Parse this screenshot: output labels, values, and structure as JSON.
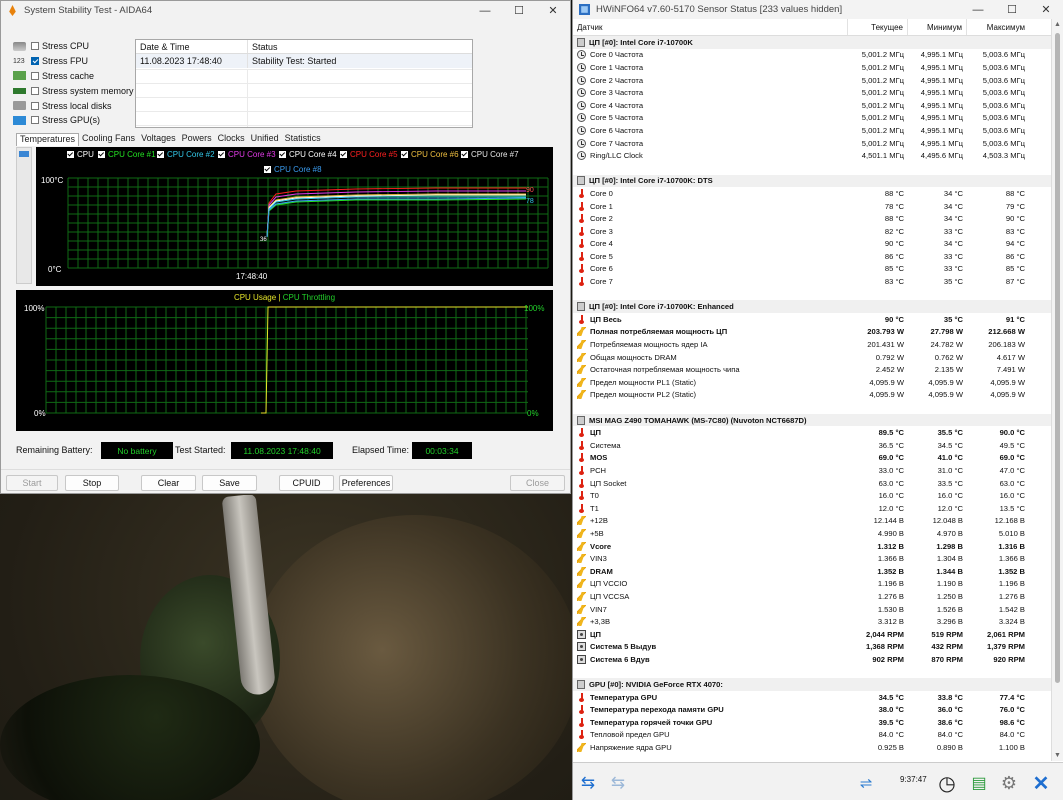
{
  "aida": {
    "title": "System Stability Test - AIDA64",
    "stress": [
      {
        "label": "Stress CPU",
        "checked": false
      },
      {
        "label": "Stress FPU",
        "checked": true
      },
      {
        "label": "Stress cache",
        "checked": false
      },
      {
        "label": "Stress system memory",
        "checked": false
      },
      {
        "label": "Stress local disks",
        "checked": false
      },
      {
        "label": "Stress GPU(s)",
        "checked": false
      }
    ],
    "log": {
      "headers": [
        "Date & Time",
        "Status"
      ],
      "rows": [
        [
          "11.08.2023 17:48:40",
          "Stability Test: Started"
        ]
      ]
    },
    "tabs": [
      "Temperatures",
      "Cooling Fans",
      "Voltages",
      "Powers",
      "Clocks",
      "Unified",
      "Statistics"
    ],
    "temp_chart": {
      "legend": [
        {
          "label": "CPU",
          "color": "#ffffff"
        },
        {
          "label": "CPU Core #1",
          "color": "#22e222"
        },
        {
          "label": "CPU Core #2",
          "color": "#33c8e8"
        },
        {
          "label": "CPU Core #3",
          "color": "#e23ae8"
        },
        {
          "label": "CPU Core #4",
          "color": "#ffffff"
        },
        {
          "label": "CPU Core #5",
          "color": "#ff2020"
        },
        {
          "label": "CPU Core #6",
          "color": "#f0c040"
        },
        {
          "label": "CPU Core #7",
          "color": "#e8e8e8"
        },
        {
          "label": "CPU Core #8",
          "color": "#3a9cf0"
        }
      ],
      "ymax": "100°C",
      "ymin": "0°C",
      "xtime": "17:48:40",
      "start_label": "36",
      "end_labels": [
        "90",
        "78"
      ]
    },
    "usage_chart": {
      "title_a": "CPU Usage",
      "sep": "|",
      "title_b": "CPU Throttling",
      "ymax_left": "100%",
      "ymin_left": "0%",
      "ymax_right": "100%",
      "ymin_right": "0%",
      "usage_end_percent": 100
    },
    "status": {
      "battery_label": "Remaining Battery:",
      "battery_value": "No battery",
      "started_label": "Test Started:",
      "started_value": "11.08.2023 17:48:40",
      "elapsed_label": "Elapsed Time:",
      "elapsed_value": "00:03:34"
    },
    "buttons": {
      "start": "Start",
      "stop": "Stop",
      "clear": "Clear",
      "save": "Save",
      "cpuid": "CPUID",
      "preferences": "Preferences",
      "close": "Close"
    }
  },
  "hw": {
    "title": "HWiNFO64 v7.60-5170 Sensor Status [233 values hidden]",
    "columns": [
      "Датчик",
      "Текущее",
      "Минимум",
      "Максимум"
    ],
    "rows": [
      {
        "t": "grp",
        "name": "ЦП [#0]: Intel Core i7-10700K"
      },
      {
        "i": "clock",
        "name": "Core 0 Частота",
        "cur": "5,001.2 МГц",
        "min": "4,995.1 МГц",
        "max": "5,003.6 МГц"
      },
      {
        "i": "clock",
        "name": "Core 1 Частота",
        "cur": "5,001.2 МГц",
        "min": "4,995.1 МГц",
        "max": "5,003.6 МГц"
      },
      {
        "i": "clock",
        "name": "Core 2 Частота",
        "cur": "5,001.2 МГц",
        "min": "4,995.1 МГц",
        "max": "5,003.6 МГц"
      },
      {
        "i": "clock",
        "name": "Core 3 Частота",
        "cur": "5,001.2 МГц",
        "min": "4,995.1 МГц",
        "max": "5,003.6 МГц"
      },
      {
        "i": "clock",
        "name": "Core 4 Частота",
        "cur": "5,001.2 МГц",
        "min": "4,995.1 МГц",
        "max": "5,003.6 МГц"
      },
      {
        "i": "clock",
        "name": "Core 5 Частота",
        "cur": "5,001.2 МГц",
        "min": "4,995.1 МГц",
        "max": "5,003.6 МГц"
      },
      {
        "i": "clock",
        "name": "Core 6 Частота",
        "cur": "5,001.2 МГц",
        "min": "4,995.1 МГц",
        "max": "5,003.6 МГц"
      },
      {
        "i": "clock",
        "name": "Core 7 Частота",
        "cur": "5,001.2 МГц",
        "min": "4,995.1 МГц",
        "max": "5,003.6 МГц"
      },
      {
        "i": "clock",
        "name": "Ring/LLC Clock",
        "cur": "4,501.1 МГц",
        "min": "4,495.6 МГц",
        "max": "4,503.3 МГц"
      },
      {
        "t": "gap"
      },
      {
        "t": "grp",
        "name": "ЦП [#0]: Intel Core i7-10700K: DTS"
      },
      {
        "i": "therm",
        "name": "Core 0",
        "cur": "88 °C",
        "min": "34 °C",
        "max": "88 °C"
      },
      {
        "i": "therm",
        "name": "Core 1",
        "cur": "78 °C",
        "min": "34 °C",
        "max": "79 °C"
      },
      {
        "i": "therm",
        "name": "Core 2",
        "cur": "88 °C",
        "min": "34 °C",
        "max": "90 °C"
      },
      {
        "i": "therm",
        "name": "Core 3",
        "cur": "82 °C",
        "min": "33 °C",
        "max": "83 °C"
      },
      {
        "i": "therm",
        "name": "Core 4",
        "cur": "90 °C",
        "min": "34 °C",
        "max": "94 °C"
      },
      {
        "i": "therm",
        "name": "Core 5",
        "cur": "86 °C",
        "min": "33 °C",
        "max": "86 °C"
      },
      {
        "i": "therm",
        "name": "Core 6",
        "cur": "85 °C",
        "min": "33 °C",
        "max": "85 °C"
      },
      {
        "i": "therm",
        "name": "Core 7",
        "cur": "83 °C",
        "min": "35 °C",
        "max": "87 °C"
      },
      {
        "t": "gap"
      },
      {
        "t": "grp",
        "name": "ЦП [#0]: Intel Core i7-10700K: Enhanced"
      },
      {
        "i": "therm",
        "b": true,
        "name": "ЦП Весь",
        "cur": "90 °C",
        "min": "35 °C",
        "max": "91 °C"
      },
      {
        "i": "bolt",
        "b": true,
        "name": "Полная потребляемая мощность ЦП",
        "cur": "203.793 W",
        "min": "27.798 W",
        "max": "212.668 W"
      },
      {
        "i": "bolt",
        "name": "Потребляемая мощность ядер IA",
        "cur": "201.431 W",
        "min": "24.782 W",
        "max": "206.183 W"
      },
      {
        "i": "bolt",
        "name": "Общая мощность DRAM",
        "cur": "0.792 W",
        "min": "0.762 W",
        "max": "4.617 W"
      },
      {
        "i": "bolt",
        "name": "Остаточная потребляемая мощность чипа",
        "cur": "2.452 W",
        "min": "2.135 W",
        "max": "7.491 W"
      },
      {
        "i": "bolt",
        "name": "Предел мощности PL1 (Static)",
        "cur": "4,095.9 W",
        "min": "4,095.9 W",
        "max": "4,095.9 W"
      },
      {
        "i": "bolt",
        "name": "Предел мощности PL2 (Static)",
        "cur": "4,095.9 W",
        "min": "4,095.9 W",
        "max": "4,095.9 W"
      },
      {
        "t": "gap"
      },
      {
        "t": "grp",
        "name": "MSI MAG Z490 TOMAHAWK (MS-7C80) (Nuvoton NCT6687D)"
      },
      {
        "i": "therm",
        "b": true,
        "name": "ЦП",
        "cur": "89.5 °C",
        "min": "35.5 °C",
        "max": "90.0 °C"
      },
      {
        "i": "therm",
        "name": "Система",
        "cur": "36.5 °C",
        "min": "34.5 °C",
        "max": "49.5 °C"
      },
      {
        "i": "therm",
        "b": true,
        "name": "MOS",
        "cur": "69.0 °C",
        "min": "41.0 °C",
        "max": "69.0 °C"
      },
      {
        "i": "therm",
        "name": "PCH",
        "cur": "33.0 °C",
        "min": "31.0 °C",
        "max": "47.0 °C"
      },
      {
        "i": "therm",
        "name": "ЦП Socket",
        "cur": "63.0 °C",
        "min": "33.5 °C",
        "max": "63.0 °C"
      },
      {
        "i": "therm",
        "name": "T0",
        "cur": "16.0 °C",
        "min": "16.0 °C",
        "max": "16.0 °C"
      },
      {
        "i": "therm",
        "name": "T1",
        "cur": "12.0 °C",
        "min": "12.0 °C",
        "max": "13.5 °C"
      },
      {
        "i": "bolt",
        "name": "+12В",
        "cur": "12.144 В",
        "min": "12.048 В",
        "max": "12.168 В"
      },
      {
        "i": "bolt",
        "name": "+5В",
        "cur": "4.990 В",
        "min": "4.970 В",
        "max": "5.010 В"
      },
      {
        "i": "bolt",
        "b": true,
        "name": "Vcore",
        "cur": "1.312 В",
        "min": "1.298 В",
        "max": "1.316 В"
      },
      {
        "i": "bolt",
        "name": "VIN3",
        "cur": "1.366 В",
        "min": "1.304 В",
        "max": "1.366 В"
      },
      {
        "i": "bolt",
        "b": true,
        "name": "DRAM",
        "cur": "1.352 В",
        "min": "1.344 В",
        "max": "1.352 В"
      },
      {
        "i": "bolt",
        "name": "ЦП VCCIO",
        "cur": "1.196 В",
        "min": "1.190 В",
        "max": "1.196 В"
      },
      {
        "i": "bolt",
        "name": "ЦП VCCSA",
        "cur": "1.276 В",
        "min": "1.250 В",
        "max": "1.276 В"
      },
      {
        "i": "bolt",
        "name": "VIN7",
        "cur": "1.530 В",
        "min": "1.526 В",
        "max": "1.542 В"
      },
      {
        "i": "bolt",
        "name": "+3,3В",
        "cur": "3.312 В",
        "min": "3.296 В",
        "max": "3.324 В"
      },
      {
        "i": "fan",
        "b": true,
        "name": "ЦП",
        "cur": "2,044 RPM",
        "min": "519 RPM",
        "max": "2,061 RPM"
      },
      {
        "i": "fan",
        "b": true,
        "name": "Система 5 Выдув",
        "cur": "1,368 RPM",
        "min": "432 RPM",
        "max": "1,379 RPM"
      },
      {
        "i": "fan",
        "b": true,
        "name": "Система 6 Вдув",
        "cur": "902 RPM",
        "min": "870 RPM",
        "max": "920 RPM"
      },
      {
        "t": "gap"
      },
      {
        "t": "grp",
        "name": "GPU [#0]: NVIDIA GeForce RTX 4070:"
      },
      {
        "i": "therm",
        "b": true,
        "name": "Температура GPU",
        "cur": "34.5 °C",
        "min": "33.8 °C",
        "max": "77.4 °C"
      },
      {
        "i": "therm",
        "b": true,
        "name": "Температура перехода памяти GPU",
        "cur": "38.0 °C",
        "min": "36.0 °C",
        "max": "76.0 °C"
      },
      {
        "i": "therm",
        "b": true,
        "name": "Температура горячей точки GPU",
        "cur": "39.5 °C",
        "min": "38.6 °C",
        "max": "98.6 °C"
      },
      {
        "i": "therm",
        "name": "Тепловой предел GPU",
        "cur": "84.0 °C",
        "min": "84.0 °C",
        "max": "84.0 °C"
      },
      {
        "i": "bolt",
        "name": "Напряжение ядра GPU",
        "cur": "0.925 В",
        "min": "0.890 В",
        "max": "1.100 В"
      }
    ],
    "footer": {
      "time": "9:37:47"
    }
  }
}
